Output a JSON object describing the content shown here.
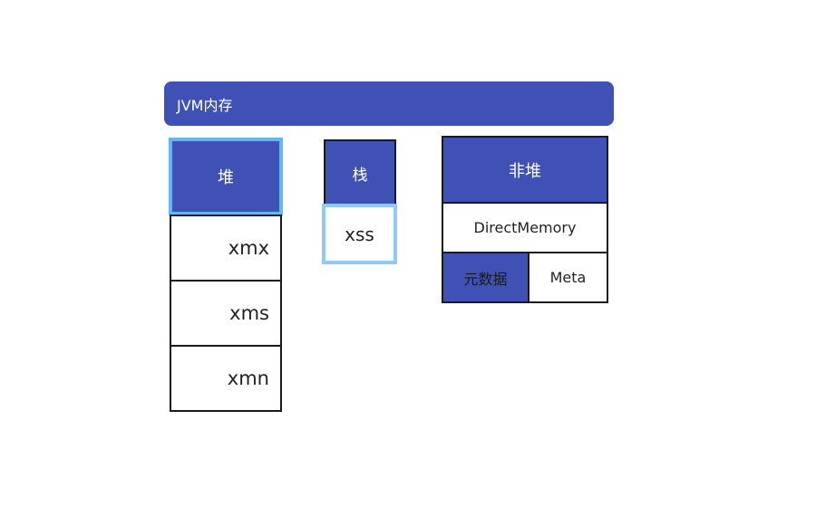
{
  "title": "JVM内存",
  "heap": {
    "label": "堆",
    "items": [
      "xmx",
      "xms",
      "xmn"
    ]
  },
  "stack": {
    "label": "栈",
    "items": [
      "xss"
    ]
  },
  "non_heap": {
    "label": "非堆",
    "direct": "DirectMemory",
    "metadata_label": "元数据",
    "meta": "Meta"
  },
  "colors": {
    "primary_blue": "#3f51b5",
    "highlight_blue": "#64b5f6",
    "light_blue": "#90caf9",
    "border_dark": "#1a1a1a"
  }
}
